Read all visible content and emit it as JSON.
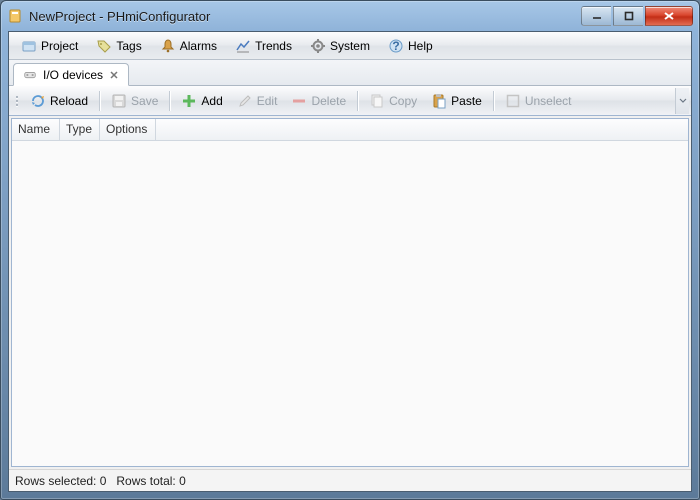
{
  "window": {
    "title": "NewProject - PHmiConfigurator"
  },
  "menubar": [
    {
      "id": "project",
      "label": "Project"
    },
    {
      "id": "tags",
      "label": "Tags"
    },
    {
      "id": "alarms",
      "label": "Alarms"
    },
    {
      "id": "trends",
      "label": "Trends"
    },
    {
      "id": "system",
      "label": "System"
    },
    {
      "id": "help",
      "label": "Help"
    }
  ],
  "tab": {
    "label": "I/O devices",
    "icon": "device-icon"
  },
  "toolbar": {
    "reload": "Reload",
    "save": "Save",
    "add": "Add",
    "edit": "Edit",
    "delete": "Delete",
    "copy": "Copy",
    "paste": "Paste",
    "unselect": "Unselect"
  },
  "grid": {
    "columns": [
      "Name",
      "Type",
      "Options"
    ]
  },
  "status": {
    "rows_selected": "Rows selected: 0",
    "rows_total": "Rows total: 0"
  }
}
